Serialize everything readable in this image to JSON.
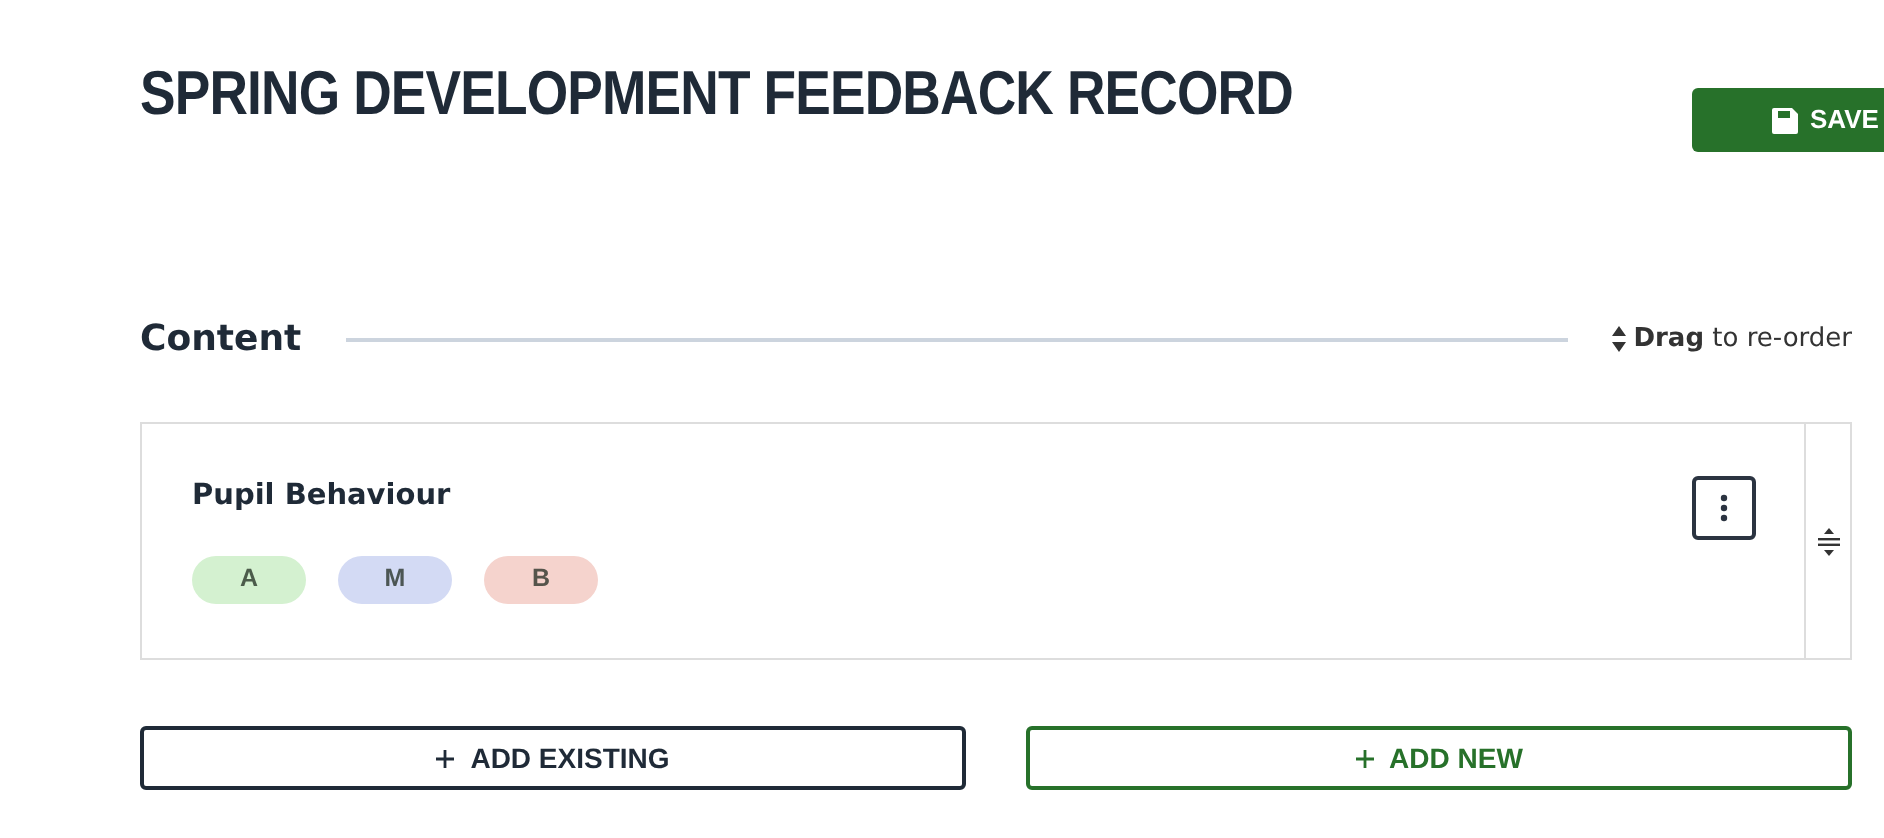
{
  "title": "SPRING DEVELOPMENT FEEDBACK RECORD",
  "save_button": {
    "label": "SAVE"
  },
  "section": {
    "heading": "Content",
    "drag_hint": "**Drag** to re-order"
  },
  "items": [
    {
      "title": "Pupil Behaviour",
      "tags": [
        {
          "label": "A",
          "color": "#d4f1d0"
        },
        {
          "label": "M",
          "color": "#d3daf4"
        },
        {
          "label": "B",
          "color": "#f5d3cd"
        }
      ]
    }
  ],
  "buttons": [
    {
      "label": "ADD EXISTING",
      "kind": "outline-dark"
    },
    {
      "label": "ADD NEW",
      "kind": "outline-success"
    }
  ]
}
